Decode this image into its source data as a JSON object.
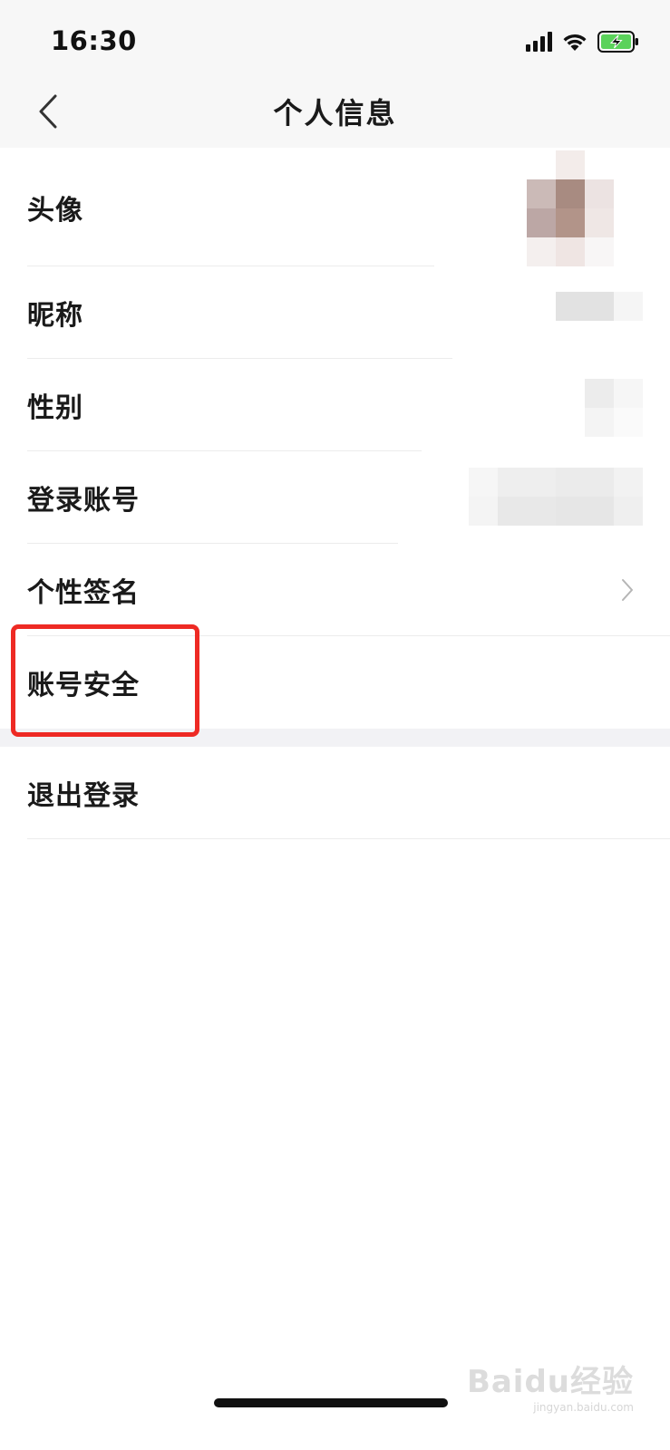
{
  "status_bar": {
    "time": "16:30",
    "icons": [
      "signal-icon",
      "wifi-icon",
      "battery-charging-icon"
    ]
  },
  "nav": {
    "title": "个人信息",
    "back_icon": "chevron-left-icon"
  },
  "rows": [
    {
      "label": "头像",
      "value_type": "blurred-avatar"
    },
    {
      "label": "昵称",
      "value_type": "blurred-text"
    },
    {
      "label": "性别",
      "value_type": "blurred-text"
    },
    {
      "label": "登录账号",
      "value_type": "blurred-text"
    },
    {
      "label": "个性签名",
      "value_type": "chevron",
      "icon": "chevron-right-icon"
    },
    {
      "label": "账号安全",
      "highlighted": true
    }
  ],
  "logout": {
    "label": "退出登录"
  },
  "colors": {
    "highlight": "#ee2a24",
    "header_bg": "#f7f7f7",
    "section_gap": "#f2f2f5",
    "battery_fill": "#5bd25b"
  },
  "watermark": {
    "brand": "Baidu经验",
    "url": "jingyan.baidu.com"
  }
}
